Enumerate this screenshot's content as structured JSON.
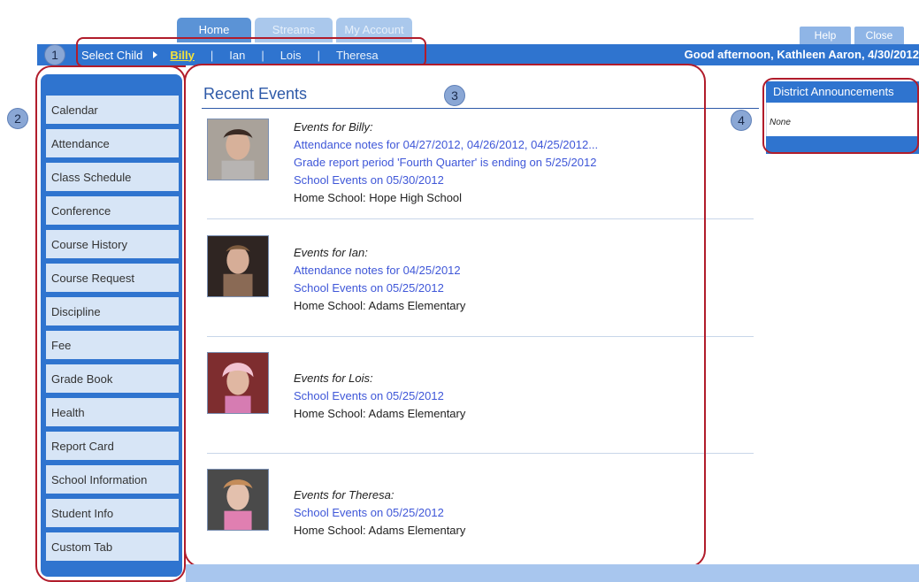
{
  "tabs": [
    {
      "label": "Home",
      "active": true
    },
    {
      "label": "Streams",
      "active": false
    },
    {
      "label": "My Account",
      "active": false
    }
  ],
  "top_buttons": {
    "help": "Help",
    "close": "Close"
  },
  "nav": {
    "select_child_label": "Select Child",
    "children": [
      "Billy",
      "Ian",
      "Lois",
      "Theresa"
    ],
    "active_child": "Billy",
    "greeting": "Good afternoon, Kathleen Aaron, 4/30/2012"
  },
  "sidebar": {
    "items": [
      "Calendar",
      "Attendance",
      "Class Schedule",
      "Conference",
      "Course History",
      "Course Request",
      "Discipline",
      "Fee",
      "Grade Book",
      "Health",
      "Report Card",
      "School Information",
      "Student Info",
      "Custom Tab"
    ]
  },
  "main": {
    "title": "Recent Events",
    "events": [
      {
        "title": "Events for Billy:",
        "links": [
          "Attendance notes for 04/27/2012, 04/26/2012, 04/25/2012...",
          "Grade report period 'Fourth Quarter' is ending on 5/25/2012",
          "School Events on 05/30/2012"
        ],
        "school": "Home School: Hope High School"
      },
      {
        "title": "Events for Ian:",
        "links": [
          "Attendance notes for 04/25/2012",
          "School Events on 05/25/2012"
        ],
        "school": "Home School: Adams Elementary"
      },
      {
        "title": "Events for Lois:",
        "links": [
          "School Events on 05/25/2012"
        ],
        "school": "Home School: Adams Elementary"
      },
      {
        "title": "Events for Theresa:",
        "links": [
          "School Events on 05/25/2012"
        ],
        "school": "Home School: Adams Elementary"
      }
    ]
  },
  "right_panel": {
    "header": "District Announcements",
    "body": "None"
  },
  "annotations": [
    "1",
    "2",
    "3",
    "4"
  ],
  "colors": {
    "primary_blue": "#2f74cf",
    "link_blue": "#3f57d8",
    "annotation_red": "#b11c2b"
  }
}
